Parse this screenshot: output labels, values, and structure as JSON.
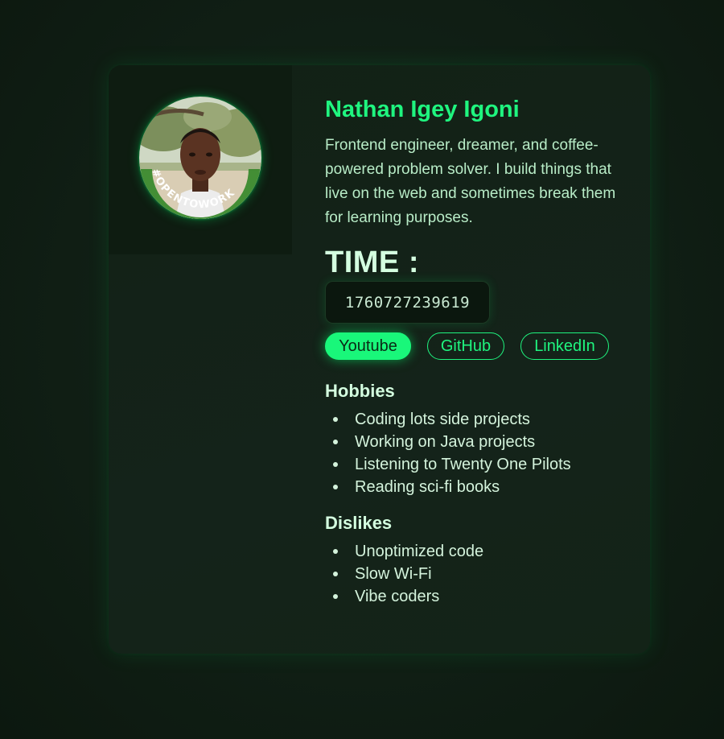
{
  "profile": {
    "name": "Nathan Igey Igoni",
    "bio": "Frontend engineer, dreamer, and coffee-powered problem solver. I build things that live on the web and sometimes break them for learning purposes.",
    "badge_text": "#OPENTOWORK"
  },
  "time": {
    "label": "TIME :",
    "value": "1760727239619"
  },
  "links": [
    {
      "label": "Youtube",
      "active": true
    },
    {
      "label": "GitHub",
      "active": false
    },
    {
      "label": "LinkedIn",
      "active": false
    }
  ],
  "hobbies": {
    "title": "Hobbies",
    "items": [
      "Coding lots side projects",
      "Working on Java projects",
      "Listening to Twenty One Pilots",
      "Reading sci-fi books"
    ]
  },
  "dislikes": {
    "title": "Dislikes",
    "items": [
      "Unoptimized code",
      "Slow Wi-Fi",
      "Vibe coders"
    ]
  },
  "colors": {
    "accent": "#1ff57f",
    "background": "#112016",
    "card": "#14231a",
    "text": "#d4f3dc"
  }
}
